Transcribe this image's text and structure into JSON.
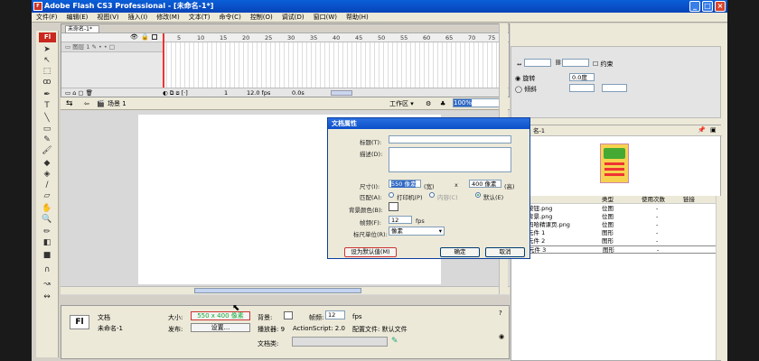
{
  "window": {
    "title": "Adobe Flash CS3 Professional - [未命名-1*]"
  },
  "menu": [
    "文件(F)",
    "编辑(E)",
    "视图(V)",
    "插入(I)",
    "修改(M)",
    "文本(T)",
    "命令(C)",
    "控制(O)",
    "调试(D)",
    "窗口(W)",
    "帮助(H)"
  ],
  "tools_logo": "Fl",
  "timeline": {
    "tab": "未命名-1*",
    "frame_numbers": [
      "5",
      "10",
      "15",
      "20",
      "25",
      "30",
      "35",
      "40",
      "45",
      "50",
      "55",
      "60",
      "65",
      "70",
      "75"
    ],
    "layer": "图层 1",
    "status_frame": "1",
    "status_fps": "12.0 fps",
    "status_time": "0.0s"
  },
  "scene": {
    "label": "场景 1",
    "workspace": "工作区",
    "zoom": "100%"
  },
  "dialog": {
    "title": "文档属性",
    "title_label": "标题(T):",
    "desc_label": "描述(D):",
    "size_label": "尺寸(I):",
    "width_value": "550 像素",
    "width_unit": "(宽)",
    "times": "x",
    "height_value": "400 像素",
    "height_unit": "(高)",
    "match_label": "匹配(A):",
    "match_printer": "打印机(P)",
    "match_content": "内容(C)",
    "match_default": "默认(E)",
    "bg_label": "背景颜色(B):",
    "fps_label": "帧频(F):",
    "fps_value": "12",
    "fps_unit": "fps",
    "ruler_label": "标尺单位(R):",
    "ruler_value": "像素",
    "btn_default": "设为默认值(M)",
    "btn_ok": "确定",
    "btn_cancel": "取消"
  },
  "properties": {
    "logo": "Fl",
    "doc_label": "文档",
    "doc_name": "未命名-1",
    "size_label": "大小:",
    "size_value": "550 x 400 像素",
    "bg_label": "背景:",
    "fps_label": "帧频:",
    "fps_value": "12",
    "fps_unit": "fps",
    "publish_label": "发布:",
    "settings_btn": "设置...",
    "player_label": "播放器: 9",
    "as_label": "ActionScript: 2.0",
    "profile_label": "配置文件: 默认文件",
    "docclass_label": "文档类:"
  },
  "align_panel": {
    "keep": "约束",
    "rotate": "旋转",
    "skew": "倾斜",
    "w_value": "0.0度"
  },
  "library": {
    "title": "名-1",
    "columns": [
      "类型",
      "使用次数",
      "链接"
    ],
    "items": [
      {
        "name": "按钮.png",
        "type": "位图",
        "count": "-"
      },
      {
        "name": "背景.png",
        "type": "位图",
        "count": "-"
      },
      {
        "name": "玛哈精课页.png",
        "type": "位图",
        "count": "-"
      },
      {
        "name": "元件 1",
        "type": "图形",
        "count": "-"
      },
      {
        "name": "元件 2",
        "type": "图形",
        "count": "-"
      },
      {
        "name": "元件 3",
        "type": "图形",
        "count": "-"
      }
    ]
  }
}
